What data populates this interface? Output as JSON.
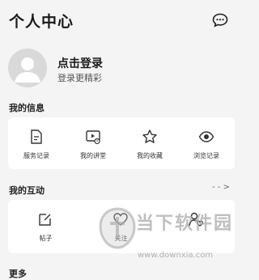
{
  "header": {
    "title": "个人中心",
    "message_icon": "chat-bubble-icon"
  },
  "profile": {
    "login_title": "点击登录",
    "login_subtitle": "登录更精彩",
    "avatar_icon": "default-avatar-icon"
  },
  "my_info": {
    "title": "我的信息",
    "items": [
      {
        "label": "服务记录",
        "icon": "document-icon"
      },
      {
        "label": "我的讲堂",
        "icon": "video-lecture-icon"
      },
      {
        "label": "我的收藏",
        "icon": "star-icon"
      },
      {
        "label": "浏览记录",
        "icon": "eye-icon"
      }
    ]
  },
  "my_interaction": {
    "title": "我的互动",
    "more": "- - >",
    "items": [
      {
        "label": "帖子",
        "icon": "edit-square-icon"
      },
      {
        "label": "关注",
        "icon": "heart-icon"
      },
      {
        "label": "",
        "icon": "user-heart-icon"
      }
    ]
  },
  "more_section": {
    "title": "更多"
  },
  "watermark": {
    "text": "当下软件园",
    "url": "www.downxia.com"
  }
}
